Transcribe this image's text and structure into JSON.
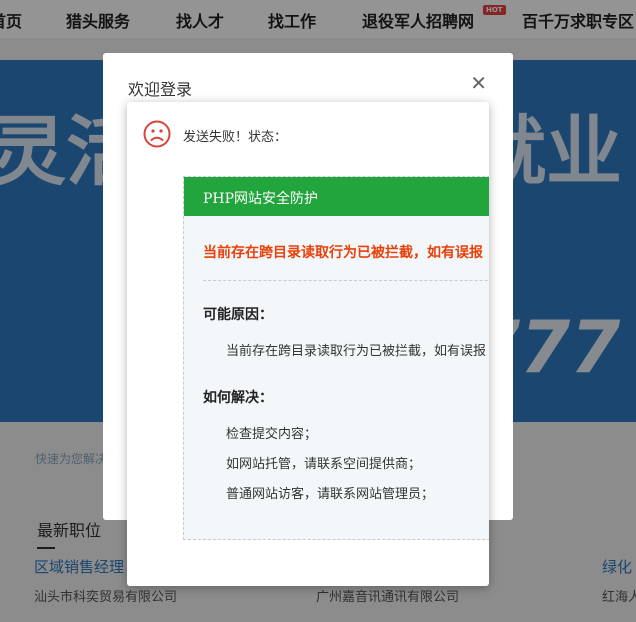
{
  "nav": {
    "items": [
      "首页",
      "猎头服务",
      "找人才",
      "找工作",
      "退役军人招聘网",
      "百千万求职专区"
    ],
    "hot_badge": "HOT"
  },
  "banner": {
    "text_left": "灵活",
    "text_right": "就业",
    "phone_fragment": "777"
  },
  "under_banner": "快速为您解决",
  "jobs": {
    "section_title": "最新职位",
    "items": [
      {
        "title": "区域销售经理",
        "company": "汕头市科奕贸易有限公司"
      },
      {
        "title": "",
        "company": "广州嘉音讯通讯有限公司"
      },
      {
        "title": "绿化",
        "company": "红海人"
      }
    ]
  },
  "login_dialog": {
    "title": "欢迎登录",
    "close_icon": "close-icon"
  },
  "error_dialog": {
    "icon": "sad-face-icon",
    "message": "发送失败！状态：",
    "waf": {
      "header": "PHP网站安全防护",
      "alert": "当前存在跨目录读取行为已被拦截，如有误报",
      "reason_title": "可能原因：",
      "reason_text": "当前存在跨目录读取行为已被拦截，如有误报",
      "solve_title": "如何解决：",
      "solve_items": [
        "检查提交内容；",
        "如网站托管，请联系空间提供商；",
        "普通网站访客，请联系网站管理员；"
      ]
    }
  },
  "colors": {
    "banner_blue": "#2f79c2",
    "waf_green": "#23a53d",
    "alert_orange": "#e8410a",
    "sad_red": "#d9443a"
  }
}
